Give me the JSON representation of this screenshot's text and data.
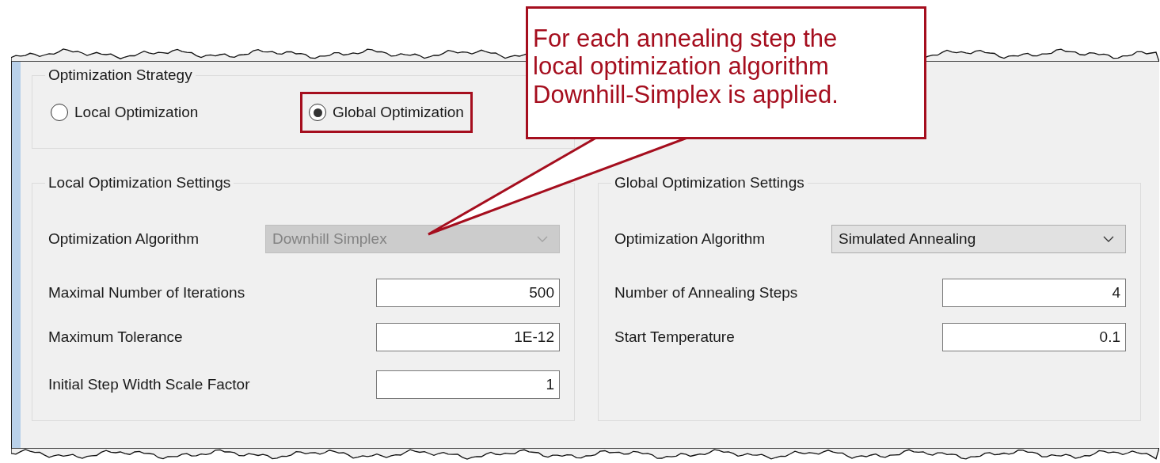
{
  "callout": {
    "text": "For each annealing step the local optimization algorithm Downhill-Simplex is applied."
  },
  "strategy": {
    "title": "Optimization Strategy",
    "options": [
      {
        "label": "Local Optimization",
        "selected": false,
        "highlighted": false
      },
      {
        "label": "Global Optimization",
        "selected": true,
        "highlighted": true
      }
    ]
  },
  "groups": [
    {
      "title": "Local Optimization Settings",
      "algorithm": {
        "label": "Optimization Algorithm",
        "value": "Downhill Simplex",
        "disabled": true
      },
      "fields": [
        {
          "label": "Maximal Number of Iterations",
          "value": "500"
        },
        {
          "label": "Maximum Tolerance",
          "value": "1E-12"
        },
        {
          "label": "Initial Step Width Scale Factor",
          "value": "1"
        }
      ]
    },
    {
      "title": "Global Optimization Settings",
      "algorithm": {
        "label": "Optimization Algorithm",
        "value": "Simulated Annealing",
        "disabled": false
      },
      "fields": [
        {
          "label": "Number of Annealing Steps",
          "value": "4"
        },
        {
          "label": "Start Temperature",
          "value": "0.1"
        }
      ]
    }
  ]
}
